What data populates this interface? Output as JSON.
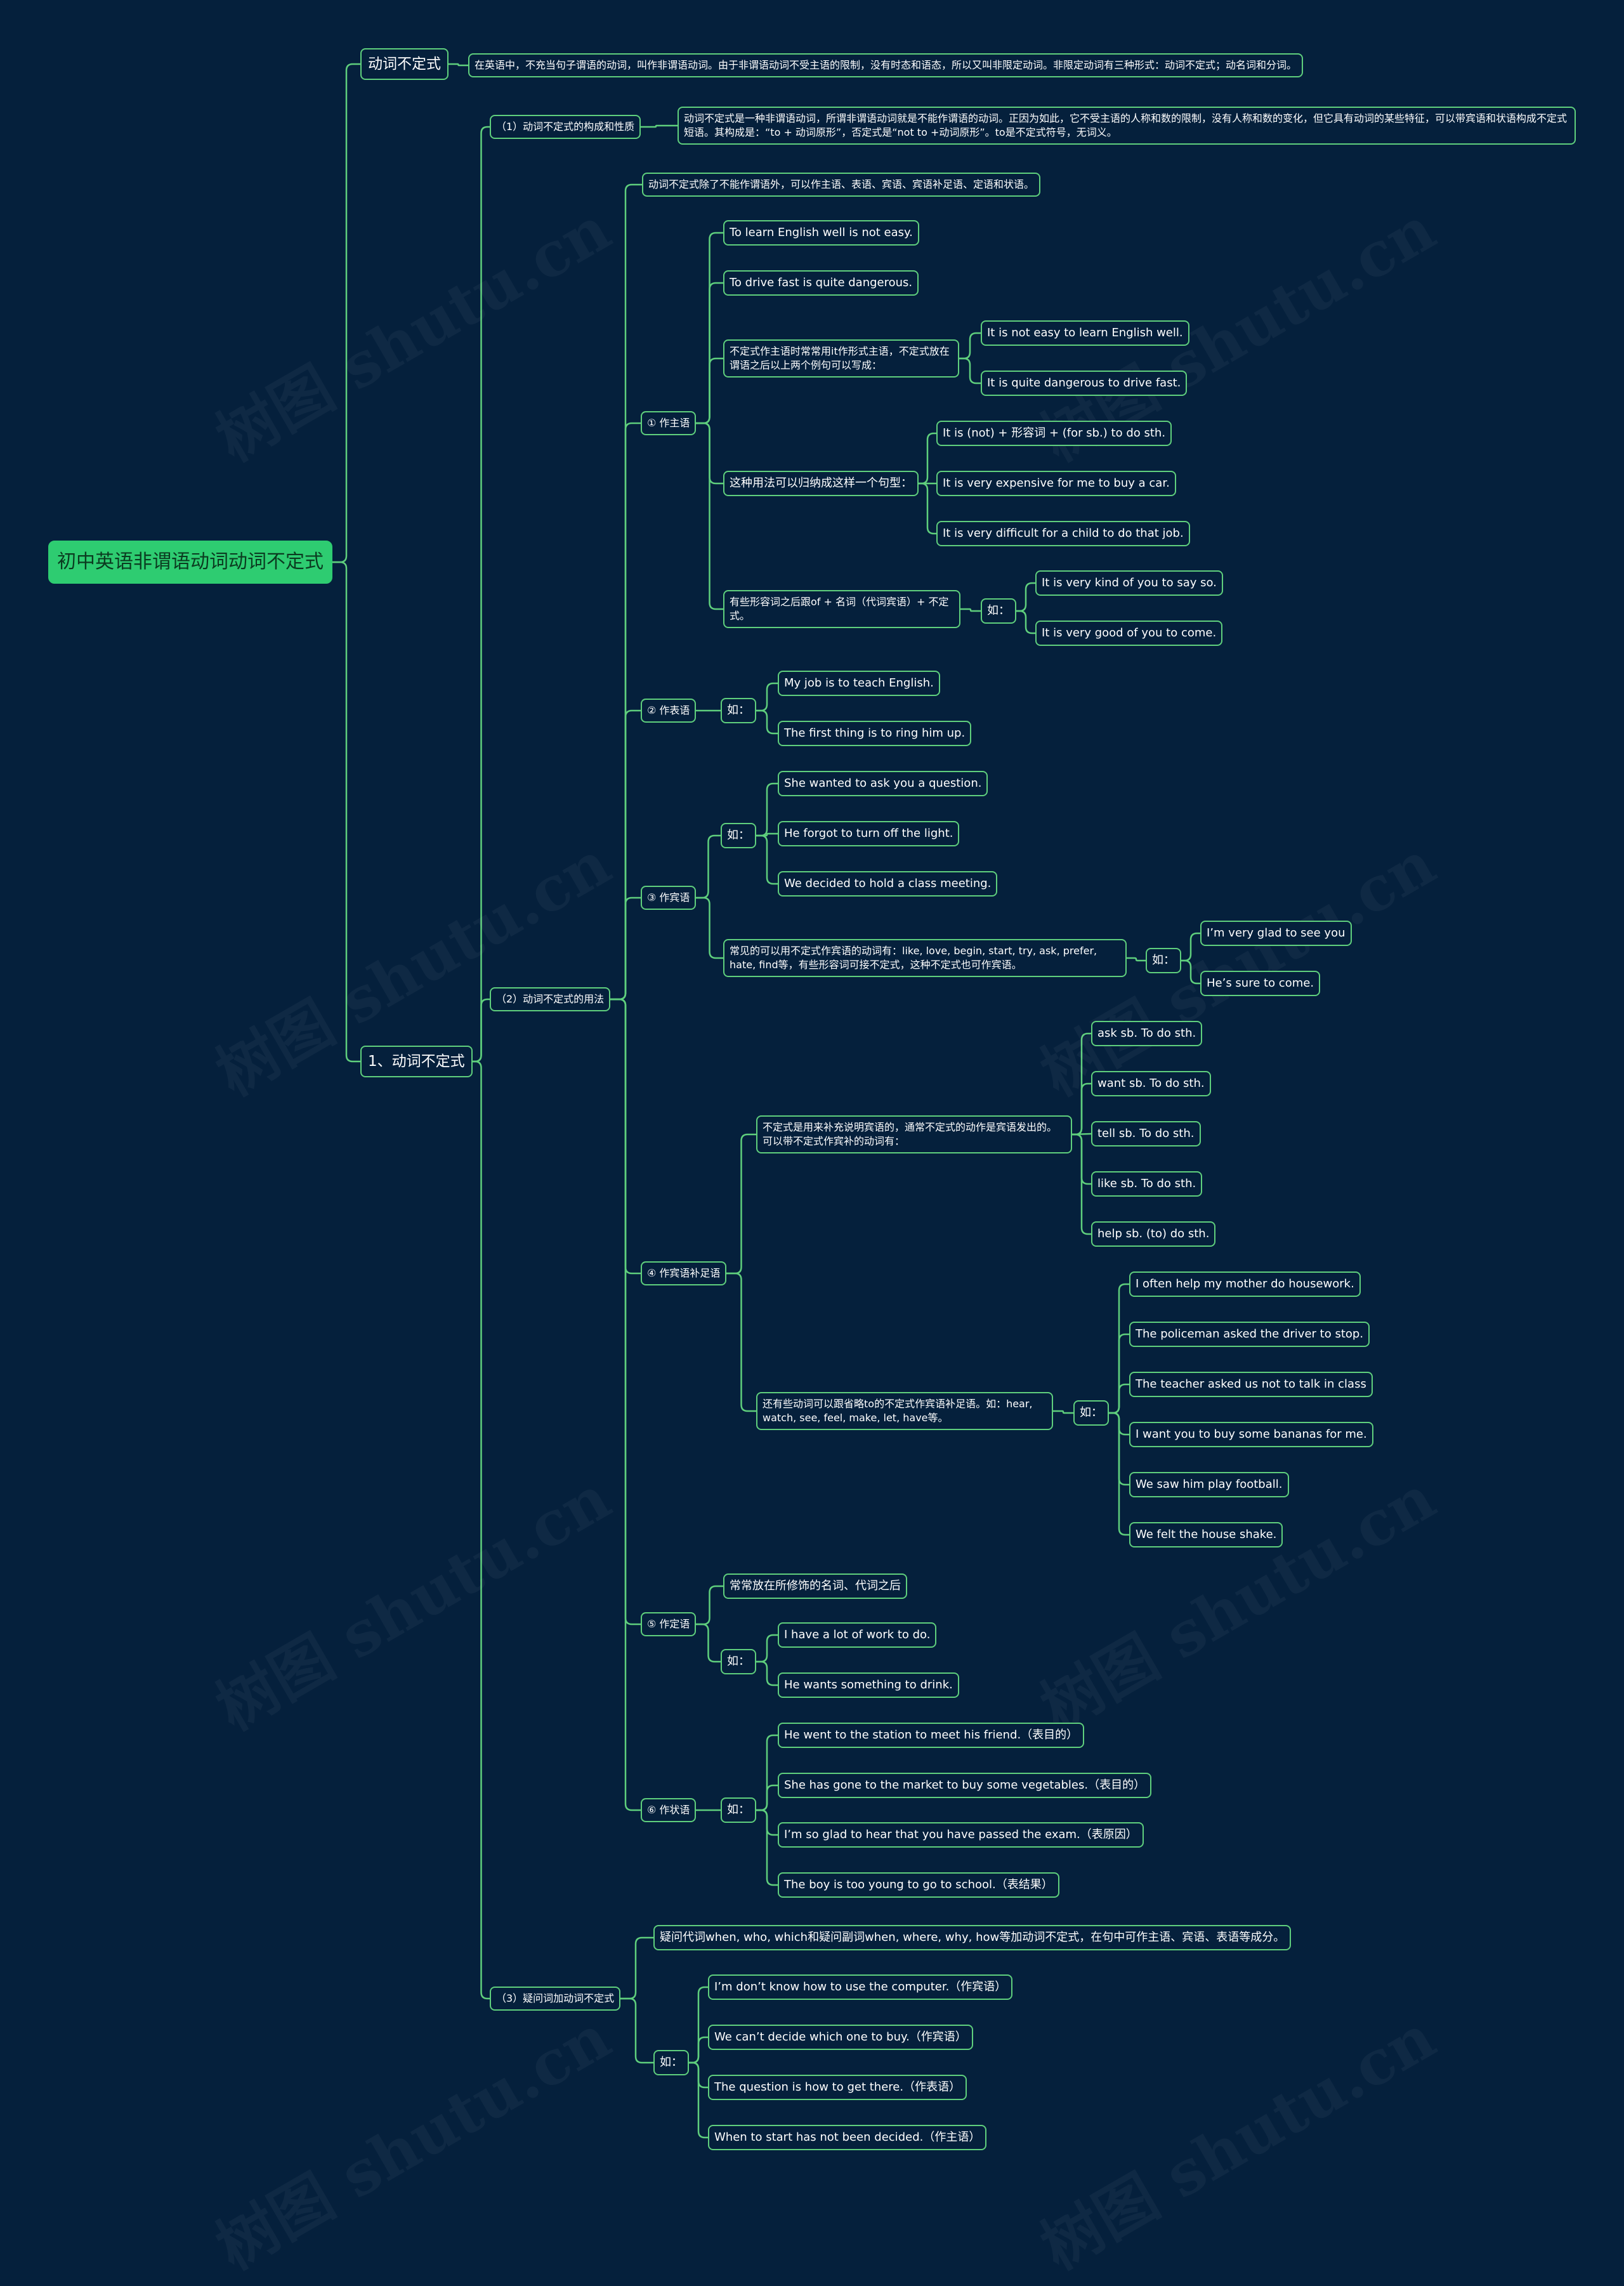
{
  "watermark": "树图 shutu.cn",
  "colors": {
    "background": "#05203c",
    "line": "#5fcf7d",
    "root": "#2ecc71",
    "text": "#ffffff"
  },
  "root": "初中英语非谓语动词动词不定式",
  "nodes": {
    "a": "动词不定式",
    "a1": "在英语中，不充当句子谓语的动词，叫作非谓语动词。由于非谓语动词不受主语的限制，没有时态和语态，所以又叫非限定动词。非限定动词有三种形式：动词不定式；动名词和分词。",
    "b": "1、动词不定式",
    "b1": "（1）动词不定式的构成和性质",
    "b1a": "动词不定式是一种非谓语动词，所谓非谓语动词就是不能作谓语的动词。正因为如此，它不受主语的人称和数的限制，没有人称和数的变化，但它具有动词的某些特征，可以带宾语和状语构成不定式短语。其构成是：“to + 动词原形”，否定式是“not to +动词原形”。to是不定式符号，无词义。",
    "b2": "（2）动词不定式的用法",
    "b2i": "动词不定式除了不能作谓语外，可以作主语、表语、宾语、宾语补足语、定语和状语。",
    "s1": "① 作主语",
    "s1a": "To learn English well is not easy.",
    "s1b": "To drive fast is quite dangerous.",
    "s1c": "不定式作主语时常常用it作形式主语，不定式放在谓语之后以上两个例句可以写成：",
    "s1c1": "It is not easy to learn English well.",
    "s1c2": "It is quite dangerous to drive fast.",
    "s1d": "这种用法可以归纳成这样一个句型：",
    "s1d1": "It is (not) + 形容词 + (for sb.) to do sth.",
    "s1d2": "It is very expensive for me to buy a car.",
    "s1d3": "It is very difficult for a child to do that job.",
    "s1e": "有些形容词之后跟of + 名词（代词宾语）+ 不定式。",
    "s1e_ru": "如：",
    "s1e1": "It is very kind of you to say so.",
    "s1e2": "It is very good of you to come.",
    "s2": "② 作表语",
    "s2_ru": "如：",
    "s2a": "My job is to teach English.",
    "s2b": "The first thing is to ring him up.",
    "s3": "③ 作宾语",
    "s3_ru": "如：",
    "s3a": "She wanted to ask you a question.",
    "s3b": "He forgot to turn off the light.",
    "s3c": "We decided to hold a class meeting.",
    "s3d": "常见的可以用不定式作宾语的动词有：like, love, begin, start, try, ask, prefer, hate, find等，有些形容词可接不定式，这种不定式也可作宾语。",
    "s3d_ru": "如：",
    "s3d1": "I’m very glad to see you",
    "s3d2": "He’s sure to come.",
    "s4": "④ 作宾语补足语",
    "s4a": "不定式是用来补充说明宾语的，通常不定式的动作是宾语发出的。可以带不定式作宾补的动词有：",
    "s4a1": "ask sb. To do sth.",
    "s4a2": "want sb. To do sth.",
    "s4a3": "tell sb. To do sth.",
    "s4a4": "like sb. To do sth.",
    "s4a5": "help sb. (to) do sth.",
    "s4b": "还有些动词可以跟省略to的不定式作宾语补足语。如：hear, watch, see, feel, make, let, have等。",
    "s4b_ru": "如：",
    "s4b1": "I often help my mother do housework.",
    "s4b2": "The policeman asked the driver to stop.",
    "s4b3": "The teacher asked us not to talk in class",
    "s4b4": "I want you to buy some bananas for me.",
    "s4b5": "We saw him play football.",
    "s4b6": "We felt the house shake.",
    "s5": "⑤ 作定语",
    "s5a": "常常放在所修饰的名词、代词之后",
    "s5_ru": "如：",
    "s5b1": "I have a lot of work to do.",
    "s5b2": "He wants something to drink.",
    "s6": "⑥ 作状语",
    "s6_ru": "如：",
    "s6a": "He went to the station to meet his friend.（表目的）",
    "s6b": "She has gone to the market to buy some vegetables.（表目的）",
    "s6c": "I’m so glad to hear that you have passed the exam.（表原因）",
    "s6d": "The boy is too young to go to school.（表结果）",
    "b3": "（3）疑问词加动词不定式",
    "b3a": "疑问代词when, who, which和疑问副词when, where, why, how等加动词不定式，在句中可作主语、宾语、表语等成分。",
    "b3_ru": "如：",
    "b3b1": "I’m don’t know how to use the computer.（作宾语）",
    "b3b2": "We can’t decide which one to buy.（作宾语）",
    "b3b3": "The question is how to get there.（作表语）",
    "b3b4": "When to start has not been decided.（作主语）"
  }
}
